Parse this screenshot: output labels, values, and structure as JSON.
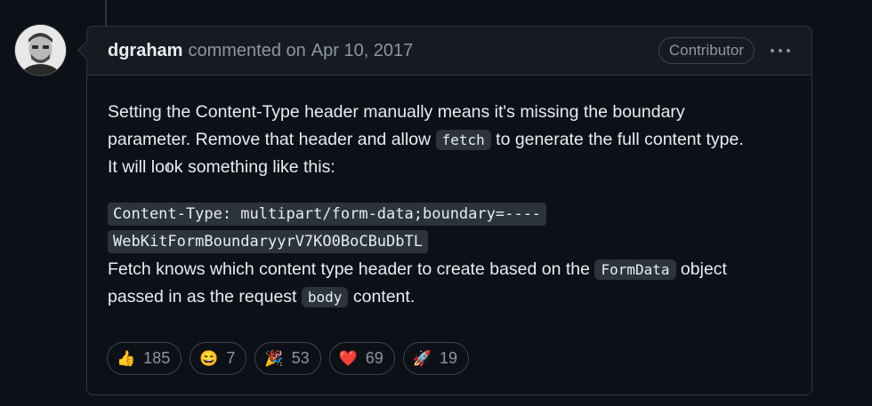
{
  "comment": {
    "author": "dgraham",
    "action": "commented on",
    "date": "Apr 10, 2017",
    "role_badge": "Contributor",
    "menu_icon": "kebab-horizontal-icon",
    "avatar_icon": "user-avatar",
    "body": {
      "para1_a": "Setting the Content-Type header manually means it's missing the boundary",
      "para1_b": "parameter. Remove that header and allow",
      "para1_code": "fetch",
      "para1_c": "to generate the full content type.",
      "para1_d": "It will look something like this:",
      "code_line_1": "Content-Type: multipart/form-data;boundary=----",
      "code_line_2": "WebKitFormBoundaryyrV7KO0BoCBuDbTL",
      "para2_a": "Fetch knows which content type header to create based on the",
      "para2_code1": "FormData",
      "para2_b": "object",
      "para2_c": "passed in as the request",
      "para2_code2": "body",
      "para2_d": "content."
    },
    "reactions": [
      {
        "emoji": "👍",
        "icon": "thumbs-up-icon",
        "count": "185"
      },
      {
        "emoji": "😄",
        "icon": "laugh-icon",
        "count": "7"
      },
      {
        "emoji": "🎉",
        "icon": "hooray-icon",
        "count": "53"
      },
      {
        "emoji": "❤️",
        "icon": "heart-icon",
        "count": "69"
      },
      {
        "emoji": "🚀",
        "icon": "rocket-icon",
        "count": "19"
      }
    ]
  },
  "colors": {
    "background": "#0d1117",
    "header_bg": "#161b22",
    "border": "#30363d",
    "text": "#e6edf3",
    "muted": "#8d96a0",
    "code_bg": "#2d333b"
  }
}
